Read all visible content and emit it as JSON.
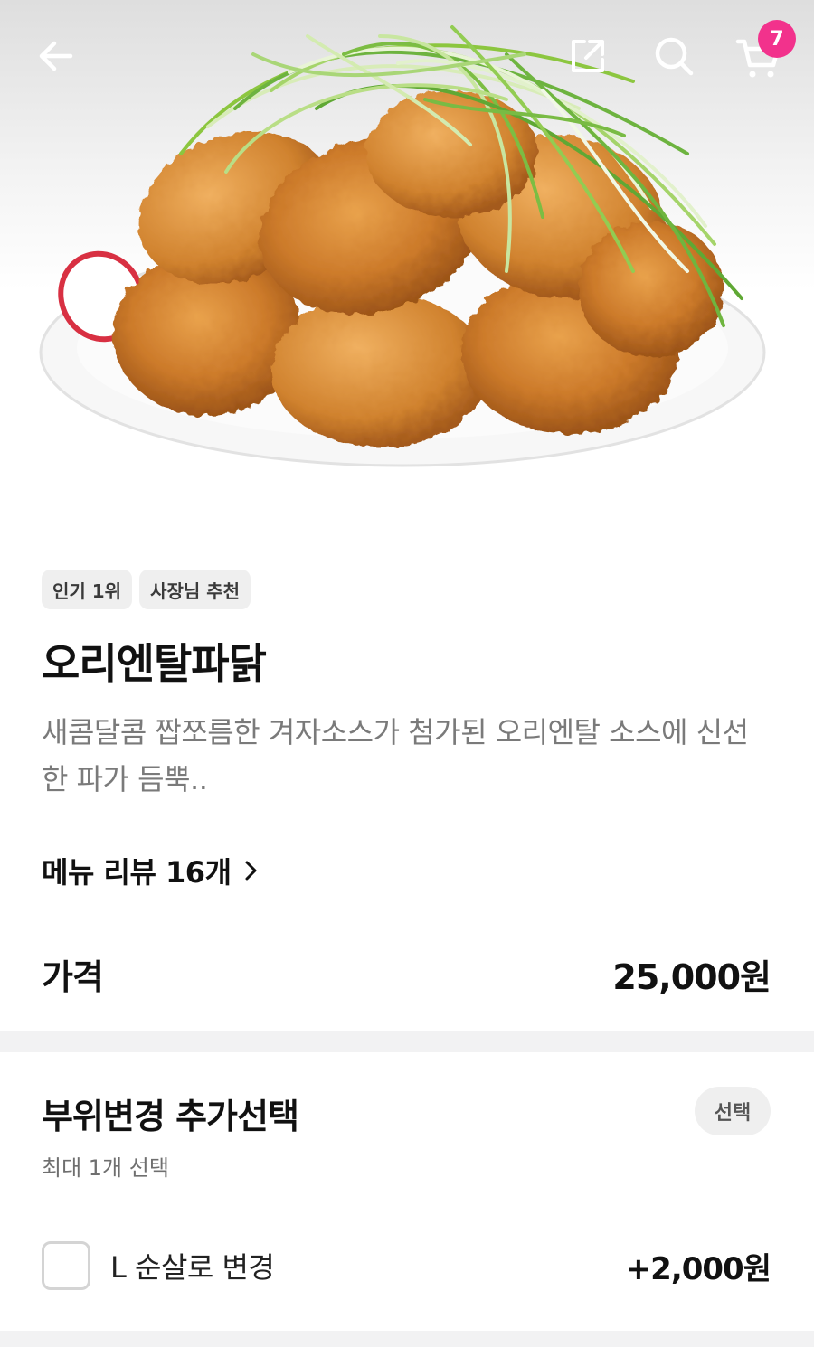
{
  "header": {
    "back_icon": "arrow-left-icon",
    "share_icon": "share-icon",
    "search_icon": "search-icon",
    "cart_icon": "cart-icon",
    "cart_count": "7",
    "badge_color": "#f2328c"
  },
  "hero": {
    "image": "fried-chicken-with-green-onion-photo"
  },
  "menu": {
    "tags": [
      "인기 1위",
      "사장님 추천"
    ],
    "title": "오리엔탈파닭",
    "description": "새콤달콤 짭쪼름한 겨자소스가 첨가된 오리엔탈 소스에 신선한 파가 듬뿍..",
    "review_link": "메뉴 리뷰 16개",
    "price_label": "가격",
    "price": "25,000원"
  },
  "option_group": {
    "title": "부위변경 추가선택",
    "badge": "선택",
    "subtitle": "최대 1개 선택",
    "options": [
      {
        "label": "L 순살로 변경",
        "price": "+2,000원",
        "checked": false
      }
    ]
  }
}
